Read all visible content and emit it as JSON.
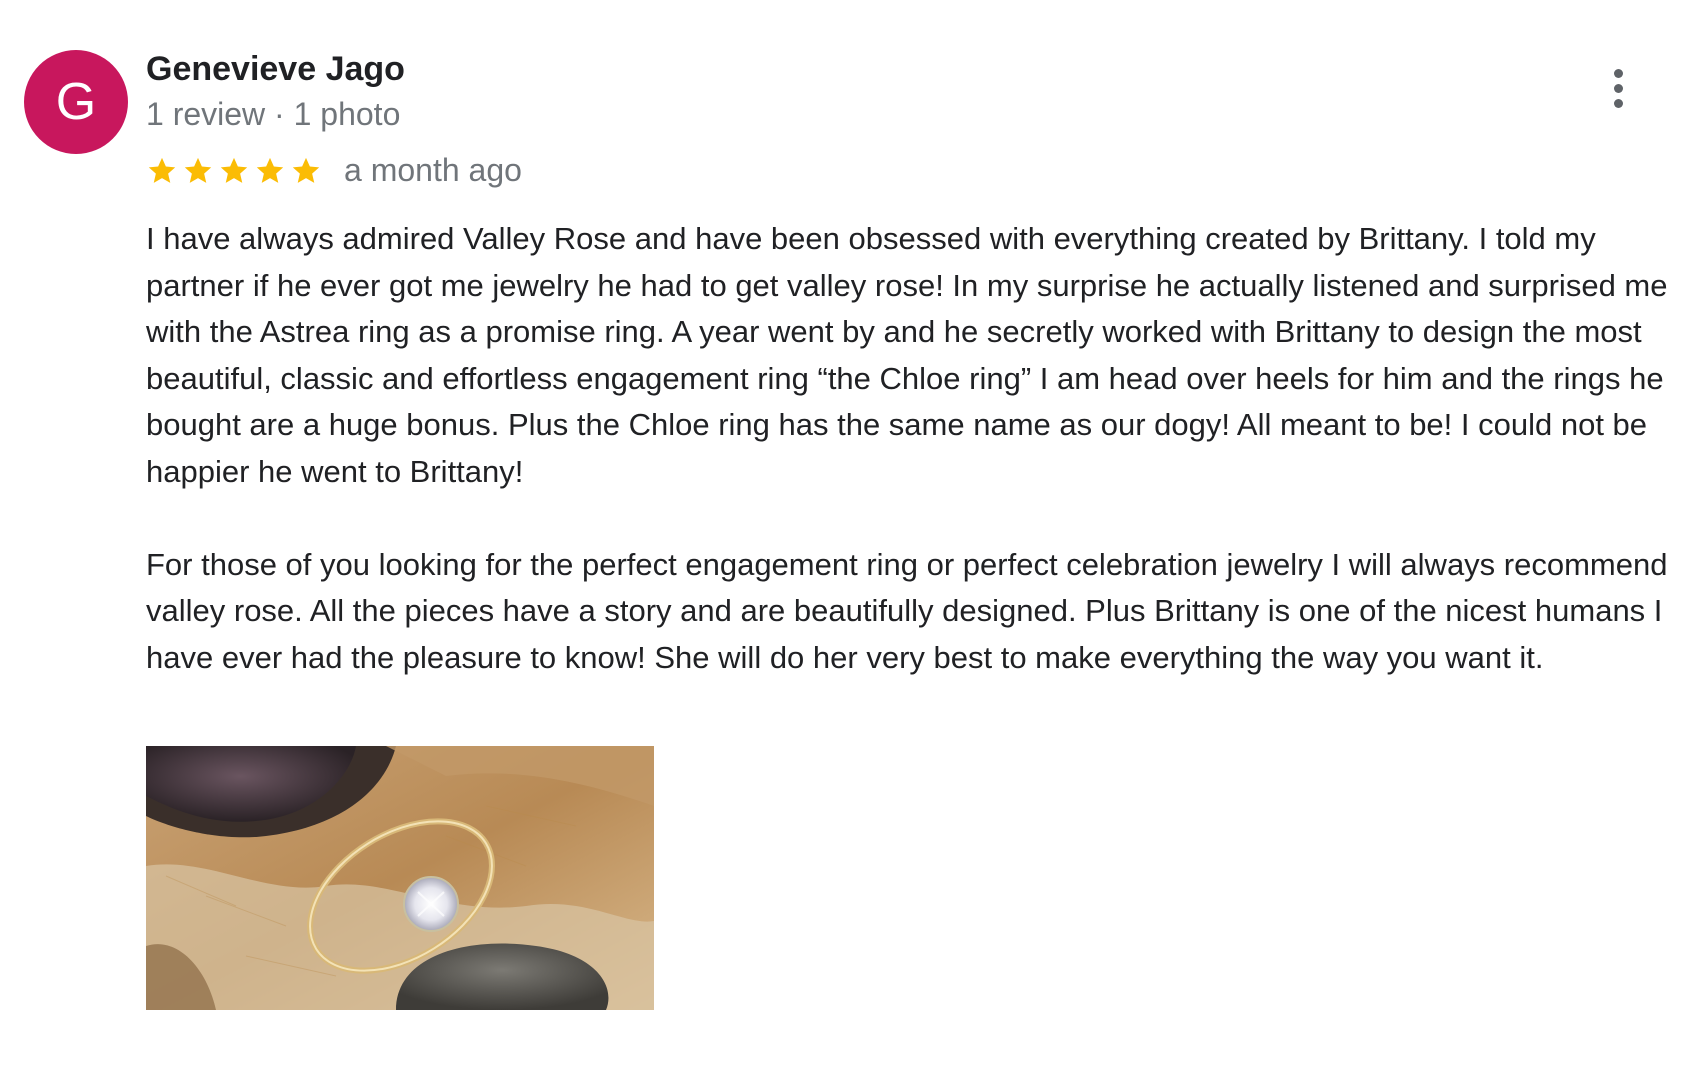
{
  "reviewer": {
    "avatar_letter": "G",
    "avatar_color": "#c8175d",
    "name": "Genevieve Jago",
    "meta": "1 review · 1 photo"
  },
  "rating": {
    "stars": 5,
    "max_stars": 5,
    "star_color": "#fbbc04",
    "date": "a month ago"
  },
  "menu": {
    "icon": "more-vert-icon"
  },
  "review": {
    "paragraphs": [
      "I have always admired Valley Rose and have been obsessed with everything created by Brittany. I told my partner if he ever got me jewelry he had to get valley rose! In my surprise he actually listened and surprised me with the Astrea ring as a promise ring. A year went by and he secretly worked with Brittany to design the most beautiful, classic and effortless engagement ring “the Chloe ring” I am head over heels for him and the rings he bought are a huge bonus. Plus the Chloe ring has the same name as our dogy! All meant to be! I could not be happier he went to Brittany!",
      "For those of you looking for the perfect engagement ring or perfect celebration jewelry I will always recommend valley rose. All the pieces have a story and are beautifully designed. Plus Brittany is one of the nicest humans I have ever had the pleasure to know! She will do her very best to make everything the way you want it."
    ]
  },
  "photo": {
    "icon": "review-photo-ring-on-dog"
  }
}
